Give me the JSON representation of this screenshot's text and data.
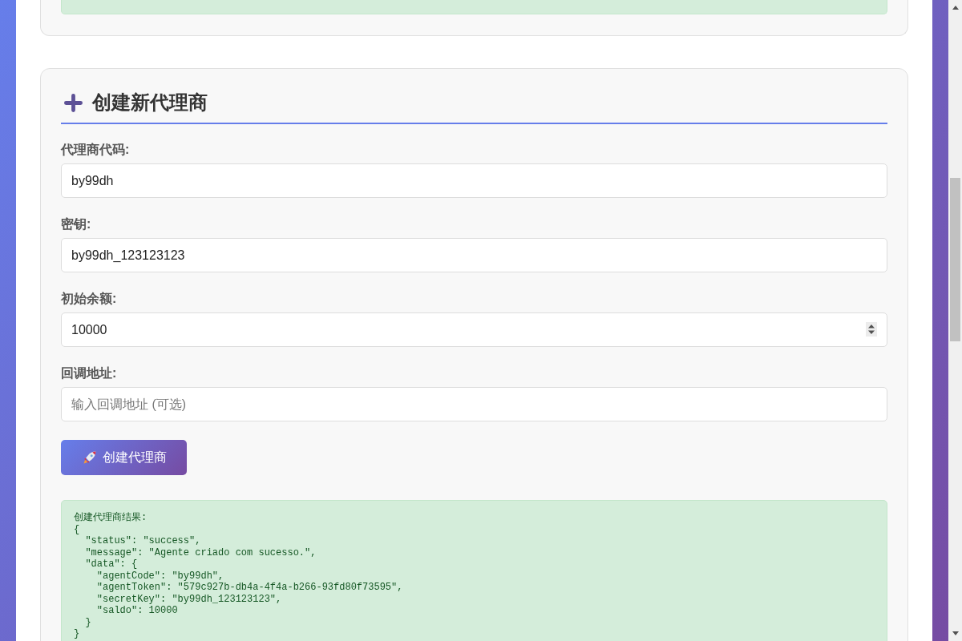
{
  "create_agent": {
    "heading": "创建新代理商",
    "fields": [
      {
        "kind": "text",
        "label": "代理商代码:",
        "value": "by99dh"
      },
      {
        "kind": "text",
        "label": "密钥:",
        "value": "by99dh_123123123"
      },
      {
        "kind": "number",
        "label": "初始余额:",
        "value": "10000"
      },
      {
        "kind": "text",
        "label": "回调地址:",
        "placeholder": "输入回调地址 (可选)"
      }
    ],
    "submit_button": {
      "label": "创建代理商"
    },
    "result": {
      "title": "创建代理商结果:",
      "lines": [
        "{",
        "  \"status\": \"success\",",
        "  \"message\": \"Agente criado com sucesso.\",",
        "  \"data\": {",
        "    \"agentCode\": \"by99dh\",",
        "    \"agentToken\": \"579c927b-db4a-4f4a-b266-93fd80f73595\",",
        "    \"secretKey\": \"by99dh_123123123\",",
        "    \"saldo\": 10000",
        "  }",
        "}"
      ]
    }
  }
}
